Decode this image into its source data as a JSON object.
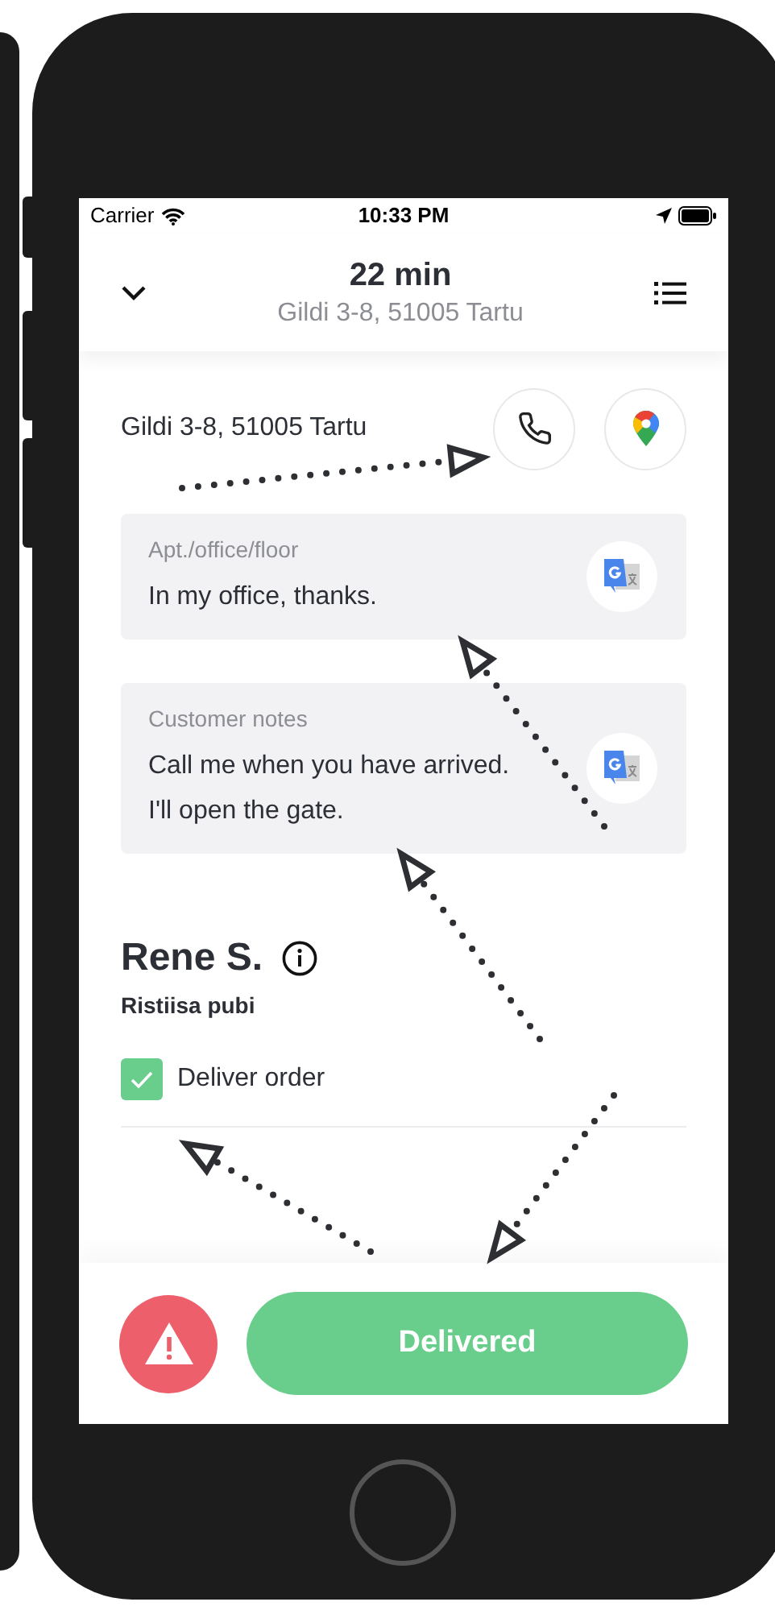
{
  "status_bar": {
    "carrier": "Carrier",
    "time": "10:33 PM"
  },
  "header": {
    "title": "22 min",
    "subtitle": "Gildi 3-8, 51005 Tartu"
  },
  "address": "Gildi 3-8, 51005 Tartu",
  "notes": [
    {
      "label": "Apt./office/floor",
      "lines": [
        "In my office, thanks."
      ]
    },
    {
      "label": "Customer notes",
      "lines": [
        "Call me when you have arrived.",
        "I'll open the gate."
      ]
    }
  ],
  "customer": {
    "name": "Rene S.",
    "venue": "Ristiisa pubi"
  },
  "tasks": [
    {
      "label": "Deliver order",
      "checked": true
    }
  ],
  "actions": {
    "primary": "Delivered"
  }
}
